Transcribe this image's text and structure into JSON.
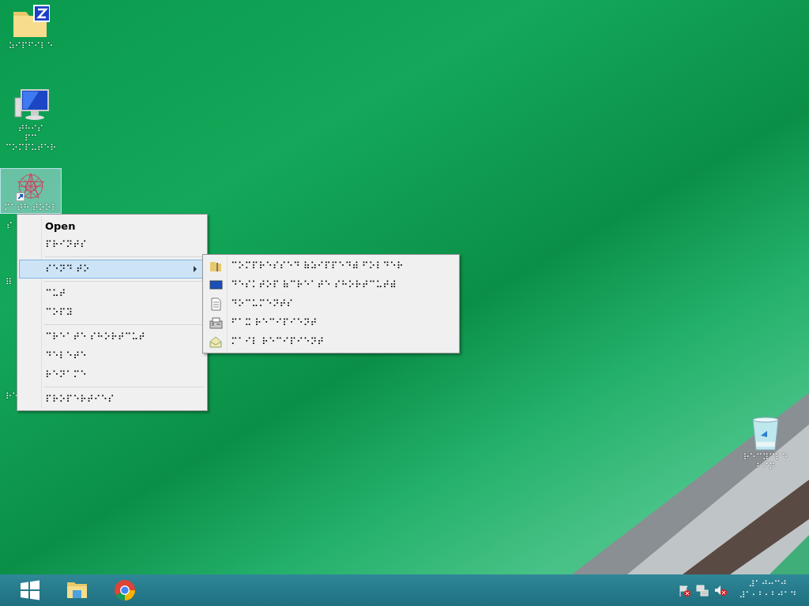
{
  "desktop": {
    "icons": [
      {
        "kind": "folder",
        "label": "⠵⠊⠏⠋⠊⠇⠑",
        "selected": false
      },
      {
        "kind": "computer",
        "label": "⠞⠓⠊⠎\n⠏⠉ ⠉⠕⠍⠏⠥⠞⠑⠗",
        "selected": false
      },
      {
        "kind": "shortcut",
        "label": "⠍⠁⠞⠓ ⠞⠕⠕⠇",
        "label_overflow": "⠎",
        "selected": true
      },
      {
        "kind": "generic",
        "label": "⠿",
        "selected": false
      },
      {
        "kind": "generic",
        "label": "⠗⠑",
        "selected": false
      }
    ],
    "recycle_bin": {
      "label": "⠗⠑⠉⠽⠉⠇⠑\n⠃⠊⠝"
    }
  },
  "context_menu": {
    "items": [
      {
        "kind": "item",
        "label": "Open",
        "default": true,
        "selected": false,
        "submenu": false
      },
      {
        "kind": "item",
        "label": "⠏⠗⠊⠝⠞⠎",
        "default": false,
        "selected": false,
        "submenu": false
      },
      {
        "kind": "separator"
      },
      {
        "kind": "item",
        "label": "⠎⠑⠝⠙ ⠞⠕",
        "default": false,
        "selected": true,
        "submenu": true
      },
      {
        "kind": "separator"
      },
      {
        "kind": "item",
        "label": "⠉⠥⠞",
        "default": false,
        "selected": false,
        "submenu": false
      },
      {
        "kind": "item",
        "label": "⠉⠕⠏⠽",
        "default": false,
        "selected": false,
        "submenu": false
      },
      {
        "kind": "separator"
      },
      {
        "kind": "item",
        "label": "⠉⠗⠑⠁⠞⠑ ⠎⠓⠕⠗⠞⠉⠥⠞",
        "default": false,
        "selected": false,
        "submenu": false
      },
      {
        "kind": "item",
        "label": "⠙⠑⠇⠑⠞⠑",
        "default": false,
        "selected": false,
        "submenu": false
      },
      {
        "kind": "item",
        "label": "⠗⠑⠝⠁⠍⠑",
        "default": false,
        "selected": false,
        "submenu": false
      },
      {
        "kind": "separator"
      },
      {
        "kind": "item",
        "label": "⠏⠗⠕⠏⠑⠗⠞⠊⠑⠎",
        "default": false,
        "selected": false,
        "submenu": false
      }
    ]
  },
  "submenu": {
    "items": [
      {
        "kind": "zip",
        "label": "⠉⠕⠍⠏⠗⠑⠎⠎⠑⠙ ⠷⠵⠊⠏⠏⠑⠙⠾ ⠋⠕⠇⠙⠑⠗"
      },
      {
        "kind": "desktop",
        "label": "⠙⠑⠎⠅⠞⠕⠏ ⠷⠉⠗⠑⠁⠞⠑ ⠎⠓⠕⠗⠞⠉⠥⠞⠾"
      },
      {
        "kind": "document",
        "label": "⠙⠕⠉⠥⠍⠑⠝⠞⠎"
      },
      {
        "kind": "fax",
        "label": "⠋⠁⠭ ⠗⠑⠉⠊⠏⠊⠑⠝⠞"
      },
      {
        "kind": "mail",
        "label": "⠍⠁⠊⠇ ⠗⠑⠉⠊⠏⠊⠑⠝⠞"
      }
    ]
  },
  "taskbar": {
    "pinned": [
      {
        "kind": "start"
      },
      {
        "kind": "explorer"
      },
      {
        "kind": "chrome"
      }
    ],
    "tray": [
      {
        "kind": "flag"
      },
      {
        "kind": "network"
      },
      {
        "kind": "volume"
      }
    ],
    "clock": {
      "time": "⠼⠁⠚⠒⠉⠚",
      "date": "⠼⠁⠂⠃⠂⠃⠚⠁⠙"
    }
  }
}
